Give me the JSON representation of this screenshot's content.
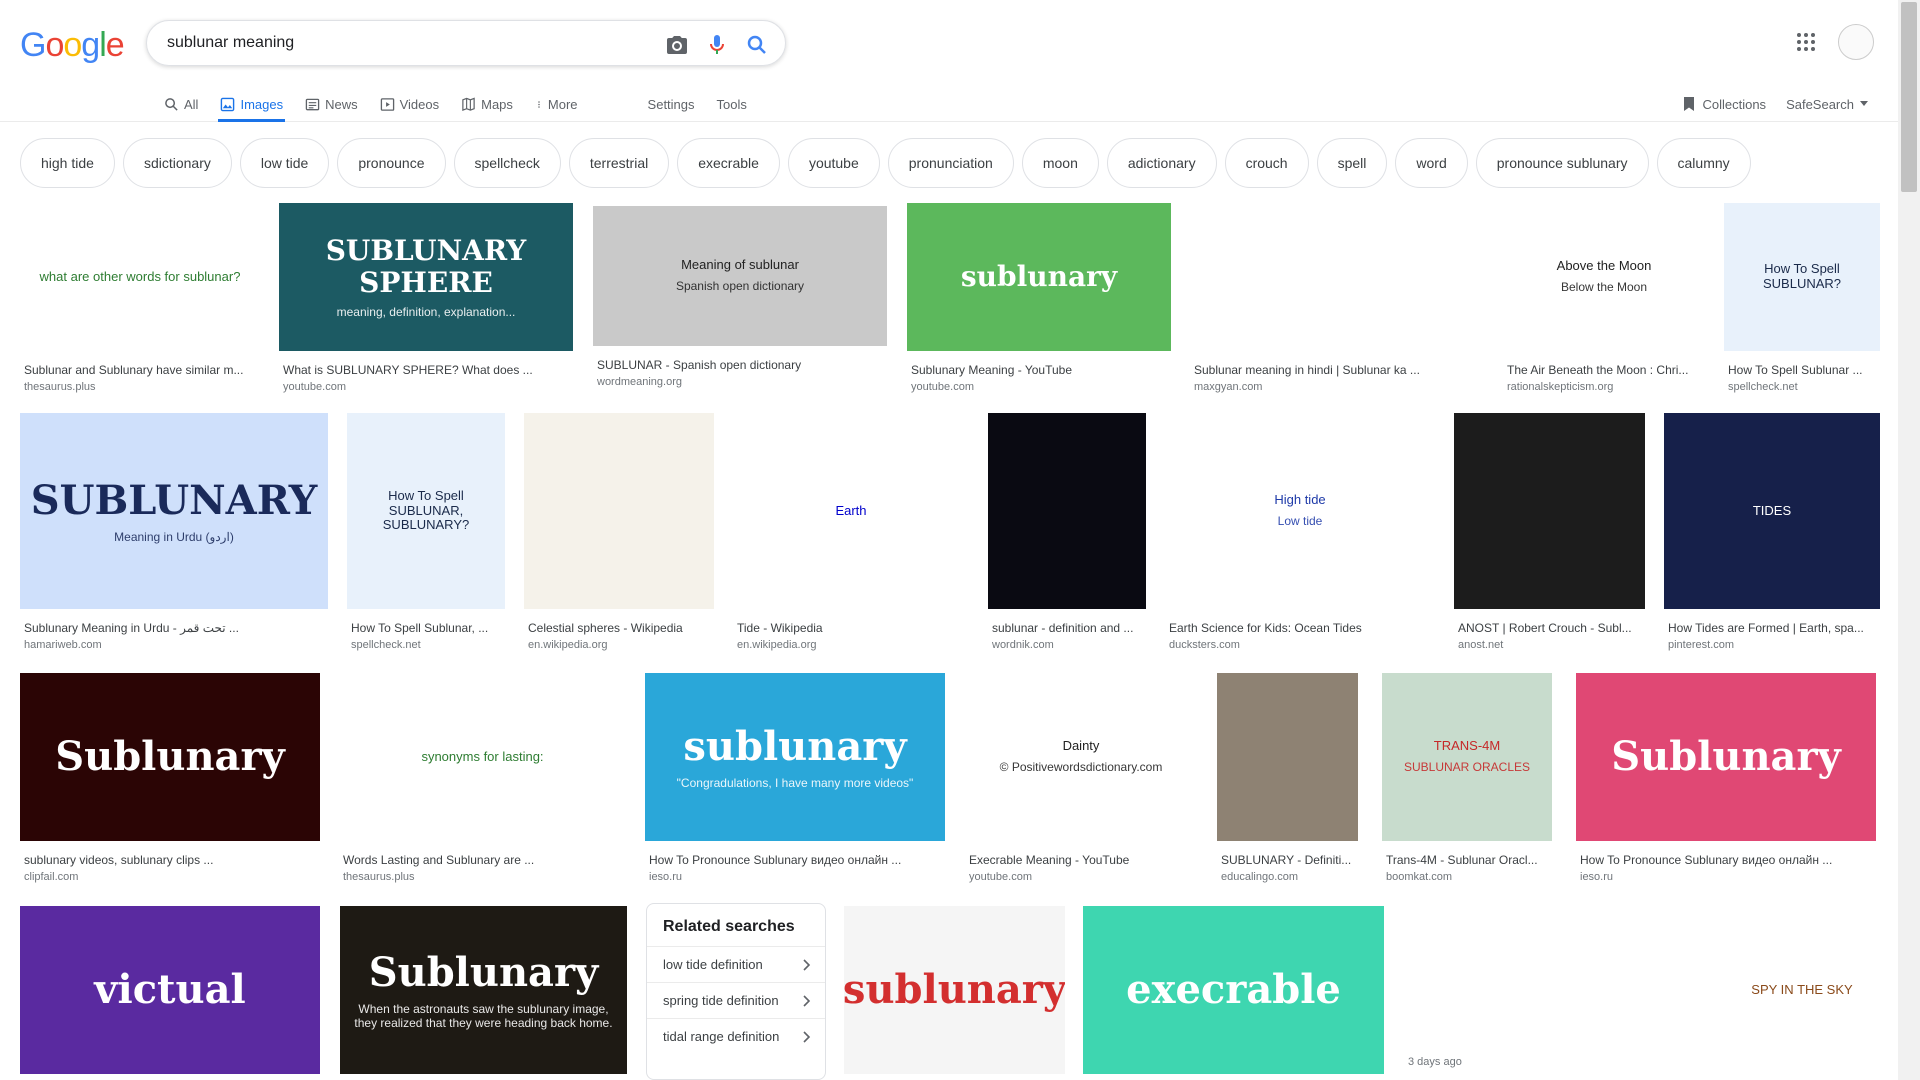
{
  "search": {
    "query": "sublunar meaning"
  },
  "tabs": [
    {
      "label": "All",
      "icon": "search-icon"
    },
    {
      "label": "Images",
      "icon": "image-icon",
      "active": true
    },
    {
      "label": "News",
      "icon": "news-icon"
    },
    {
      "label": "Videos",
      "icon": "video-icon"
    },
    {
      "label": "Maps",
      "icon": "map-icon"
    },
    {
      "label": "More",
      "icon": "more-icon"
    }
  ],
  "tools": {
    "settings": "Settings",
    "tools": "Tools",
    "collections": "Collections",
    "safesearch": "SafeSearch"
  },
  "chips": [
    "high tide",
    "sdictionary",
    "low tide",
    "pronounce",
    "spellcheck",
    "terrestrial",
    "execrable",
    "youtube",
    "pronunciation",
    "moon",
    "adictionary",
    "crouch",
    "spell",
    "word",
    "pronounce sublunary",
    "calumny"
  ],
  "results": [
    {
      "caption": "Sublunar and Sublunary have similar m...",
      "source": "thesaurus.plus",
      "text": "what are other words for sublunar?",
      "bg": "#ffffff",
      "fg": "#2e7d32"
    },
    {
      "caption": "What is SUBLUNARY SPHERE? What does ...",
      "source": "youtube.com",
      "text": "SUBLUNARY SPHERE",
      "subtext": "meaning, definition, explanation...",
      "bg": "#1c5a63",
      "fg": "#ffffff"
    },
    {
      "caption": "SUBLUNAR - Spanish open dictionary",
      "source": "wordmeaning.org",
      "text": "Meaning of sublunar",
      "subtext": "Spanish open dictionary",
      "bg": "#c9c9c9",
      "fg": "#222222"
    },
    {
      "caption": "Sublunary Meaning - YouTube",
      "source": "youtube.com",
      "text": "sublunary",
      "bg": "#5cb85c",
      "fg": "#ffffff"
    },
    {
      "caption": "Sublunar meaning in hindi | Sublunar ka ...",
      "source": "maxgyan.com",
      "bg": "#ffffff",
      "fg": "#4a78d6"
    },
    {
      "caption": "The Air Beneath the Moon : Chri...",
      "source": "rationalskepticism.org",
      "text": "Above the Moon",
      "subtext": "Below the Moon",
      "bg": "#ffffff",
      "fg": "#222222"
    },
    {
      "caption": "How To Spell Sublunar ...",
      "source": "spellcheck.net",
      "text": "How To Spell SUBLUNAR?",
      "bg": "#e8f1fb",
      "fg": "#1a2a4a"
    },
    {
      "caption": "Sublunary Meaning in Urdu - تحت قمر ...",
      "source": "hamariweb.com",
      "text": "SUBLUNARY",
      "subtext": "Meaning in Urdu (اردو)",
      "bg": "#cfe0fb",
      "fg": "#1a2a5a"
    },
    {
      "caption": "How To Spell Sublunar, ...",
      "source": "spellcheck.net",
      "text": "How To Spell SUBLUNAR, SUBLUNARY?",
      "bg": "#e8f1fb",
      "fg": "#1a2a4a"
    },
    {
      "caption": "Celestial spheres - Wikipedia",
      "source": "en.wikipedia.org",
      "bg": "#f5f2ea",
      "fg": "#333333"
    },
    {
      "caption": "Tide - Wikipedia",
      "source": "en.wikipedia.org",
      "text": "Earth",
      "bg": "#ffffff",
      "fg": "#0000cc"
    },
    {
      "caption": "sublunar - definition and ...",
      "source": "wordnik.com",
      "bg": "#0a0a12",
      "fg": "#d9c27a"
    },
    {
      "caption": "Earth Science for Kids: Ocean Tides",
      "source": "ducksters.com",
      "text": "High tide",
      "subtext": "Low tide",
      "bg": "#ffffff",
      "fg": "#1e3aa8"
    },
    {
      "caption": "ANOST | Robert Crouch - Subl...",
      "source": "anost.net",
      "bg": "#1c1c1c",
      "fg": "#bbbbbb"
    },
    {
      "caption": "How Tides are Formed | Earth, spa...",
      "source": "pinterest.com",
      "text": "TIDES",
      "bg": "#16204a",
      "fg": "#ffffff"
    },
    {
      "caption": "sublunary videos, sublunary clips ...",
      "source": "clipfail.com",
      "text": "Sublunary",
      "bg": "#2b0505",
      "fg": "#ffffff"
    },
    {
      "caption": "Words Lasting and Sublunary are ...",
      "source": "thesaurus.plus",
      "text": "synonyms for lasting:",
      "bg": "#ffffff",
      "fg": "#2e7d32"
    },
    {
      "caption": "How To Pronounce Sublunary видео онлайн ...",
      "source": "ieso.ru",
      "text": "sublunary",
      "subtext": "\"Congradulations, I have many more videos\"",
      "bg": "#2aa7d9",
      "fg": "#ffffff"
    },
    {
      "caption": "Execrable Meaning - YouTube",
      "source": "youtube.com",
      "text": "Dainty",
      "subtext": "© Positivewordsdictionary.com",
      "bg": "#ffffff",
      "fg": "#222222"
    },
    {
      "caption": "SUBLUNARY - Definiti...",
      "source": "educalingo.com",
      "bg": "#8e8273",
      "fg": "#ffffff"
    },
    {
      "caption": "Trans-4M - Sublunar Oracl...",
      "source": "boomkat.com",
      "text": "TRANS-4M",
      "subtext": "SUBLUNAR ORACLES",
      "bg": "#c8dccd",
      "fg": "#c62828"
    },
    {
      "caption": "How To Pronounce Sublunary видео онлайн ...",
      "source": "ieso.ru",
      "text": "Sublunary",
      "bg": "#e04874",
      "fg": "#ffffff"
    },
    {
      "text": "victual",
      "bg": "#5a2aa0",
      "fg": "#ffffff"
    },
    {
      "text": "Sublunary",
      "subtext": "When the astronauts saw the sublunary image, they realized that they were heading back home.",
      "bg": "#1e1a14",
      "fg": "#ffffff"
    },
    {
      "text": "sublunary",
      "bg": "#f5f5f5",
      "fg": "#d32f2f"
    },
    {
      "text": "execrable",
      "bg": "#3ed6b0",
      "fg": "#ffffff"
    },
    {
      "badge": "3 days ago",
      "bg": "#ffffff",
      "fg": "#444444"
    },
    {
      "text": "SPY IN THE SKY",
      "bg": "#ffffff",
      "fg": "#8a4a1a"
    }
  ],
  "related": {
    "heading": "Related searches",
    "items": [
      "low tide definition",
      "spring tide definition",
      "tidal range definition"
    ]
  },
  "colors": {
    "accent": "#1a73e8",
    "chip_border": "#dfe1e5"
  }
}
